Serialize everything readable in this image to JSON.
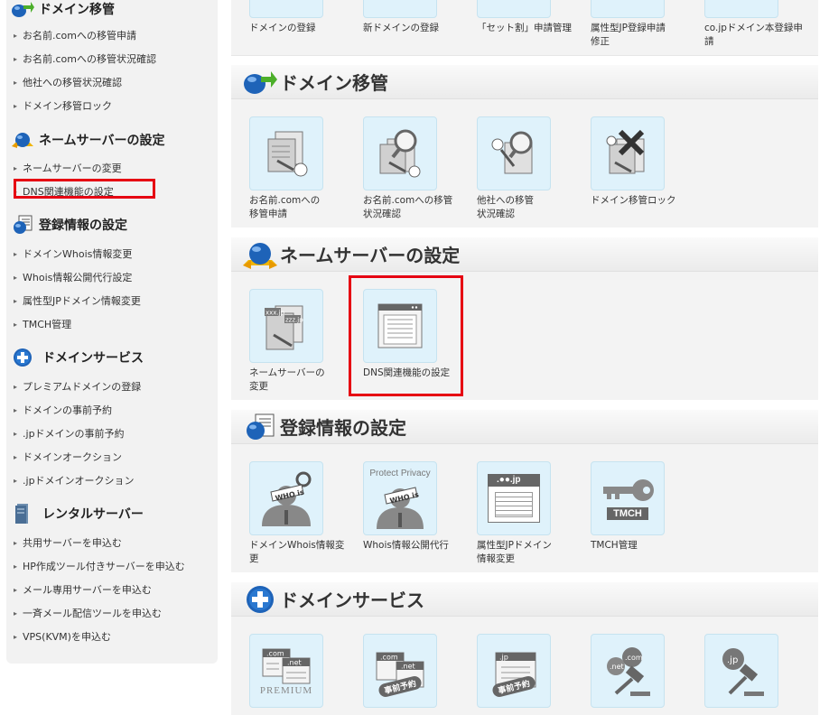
{
  "sidebar": {
    "groups": [
      {
        "title": "ドメイン移管",
        "icon": "domain-transfer-icon",
        "items": [
          "お名前.comへの移管申請",
          "お名前.comへの移管状況確認",
          "他社への移管状況確認",
          "ドメイン移管ロック"
        ]
      },
      {
        "title": "ネームサーバーの設定",
        "icon": "nameserver-icon",
        "items": [
          "ネームサーバーの変更",
          "DNS関連機能の設定"
        ]
      },
      {
        "title": "登録情報の設定",
        "icon": "registration-info-icon",
        "items": [
          "ドメインWhois情報変更",
          "Whois情報公開代行設定",
          "属性型JPドメイン情報変更",
          "TMCH管理"
        ]
      },
      {
        "title": "ドメインサービス",
        "icon": "plus-circle-icon",
        "items": [
          "プレミアムドメインの登録",
          "ドメインの事前予約",
          ".jpドメインの事前予約",
          "ドメインオークション",
          ".jpドメインオークション"
        ]
      },
      {
        "title": "レンタルサーバー",
        "icon": "server-icon",
        "items": [
          "共用サーバーを申込む",
          "HP作成ツール付きサーバーを申込む",
          "メール専用サーバーを申込む",
          "一斉メール配信ツールを申込む",
          "VPS(KVM)を申込む"
        ]
      }
    ]
  },
  "main": {
    "top_row": [
      "ドメインの登録",
      "新ドメインの登録",
      "「セット割」申請管理",
      "属性型JP登録申請\n修正",
      "co.jpドメイン本登録申\n請"
    ],
    "sections": [
      {
        "title": "ドメイン移管",
        "icon": "domain-transfer-icon",
        "tiles": [
          {
            "label": "お名前.comへの\n移管申請",
            "icon": "transfer-apply-icon"
          },
          {
            "label": "お名前.comへの移管\n状況確認",
            "icon": "transfer-status-icon"
          },
          {
            "label": "他社への移管\n状況確認",
            "icon": "transfer-out-status-icon"
          },
          {
            "label": "ドメイン移管ロック",
            "icon": "transfer-lock-icon"
          }
        ]
      },
      {
        "title": "ネームサーバーの設定",
        "icon": "nameserver-icon",
        "tiles": [
          {
            "label": "ネームサーバーの\n変更",
            "icon": "nameserver-change-icon"
          },
          {
            "label": "DNS関連機能の設定",
            "icon": "dns-settings-icon"
          }
        ]
      },
      {
        "title": "登録情報の設定",
        "icon": "registration-info-icon",
        "tiles": [
          {
            "label": "ドメインWhois情報変\n更",
            "icon": "whois-change-icon"
          },
          {
            "label": "Whois情報公開代行",
            "icon": "whois-privacy-icon",
            "badge": "Protect Privacy"
          },
          {
            "label": "属性型JPドメイン\n情報変更",
            "icon": "jp-domain-info-icon",
            "badge": ".●●.jp"
          },
          {
            "label": "TMCH管理",
            "icon": "tmch-key-icon",
            "badge": "TMCH"
          }
        ]
      },
      {
        "title": "ドメインサービス",
        "icon": "plus-circle-icon",
        "tiles": [
          {
            "label": "",
            "icon": "premium-domain-icon",
            "badge": "PREMIUM"
          },
          {
            "label": "",
            "icon": "domain-preorder-icon",
            "badge": "事前予約"
          },
          {
            "label": "",
            "icon": "jp-preorder-icon",
            "badge": "事前予約"
          },
          {
            "label": "",
            "icon": "auction-icon",
            "badge": ".com .net"
          },
          {
            "label": "",
            "icon": "jp-auction-icon",
            "badge": ".jp"
          }
        ]
      }
    ]
  },
  "colors": {
    "highlight": "#e60012",
    "tile_bg": "#dff2fb",
    "accent_blue": "#1e63b8"
  }
}
